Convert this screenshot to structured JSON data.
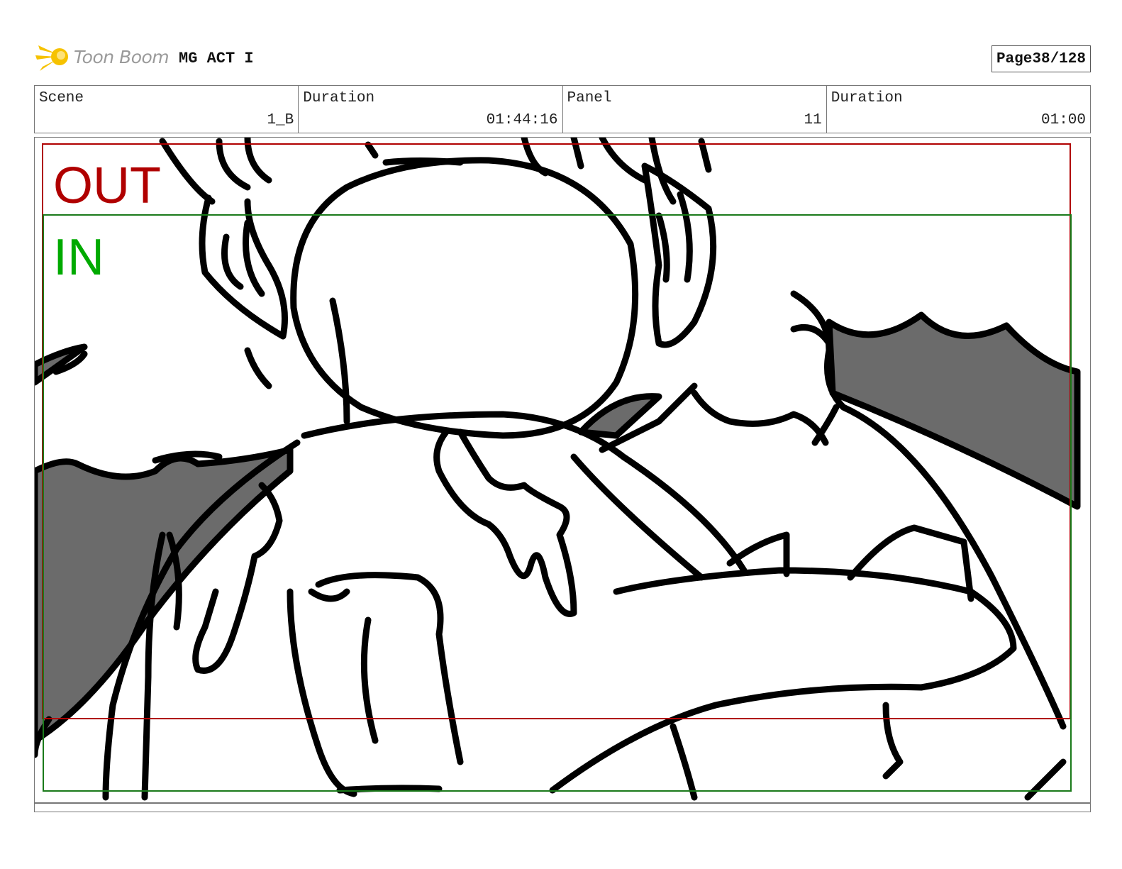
{
  "header": {
    "brand": "Toon Boom",
    "project": "MG ACT I",
    "page_label": "Page",
    "page_value": "38/128"
  },
  "info": {
    "scene_label": "Scene",
    "scene_value": "1_B",
    "scene_duration_label": "Duration",
    "scene_duration_value": "01:44:16",
    "panel_label": "Panel",
    "panel_value": "11",
    "panel_duration_label": "Duration",
    "panel_duration_value": "01:00"
  },
  "panel": {
    "out_label": "OUT",
    "in_label": "IN"
  },
  "colors": {
    "out_frame": "#b00000",
    "in_frame": "#1a7a1a",
    "logo": "#f6c200",
    "fill_gray": "#6b6b6b"
  }
}
